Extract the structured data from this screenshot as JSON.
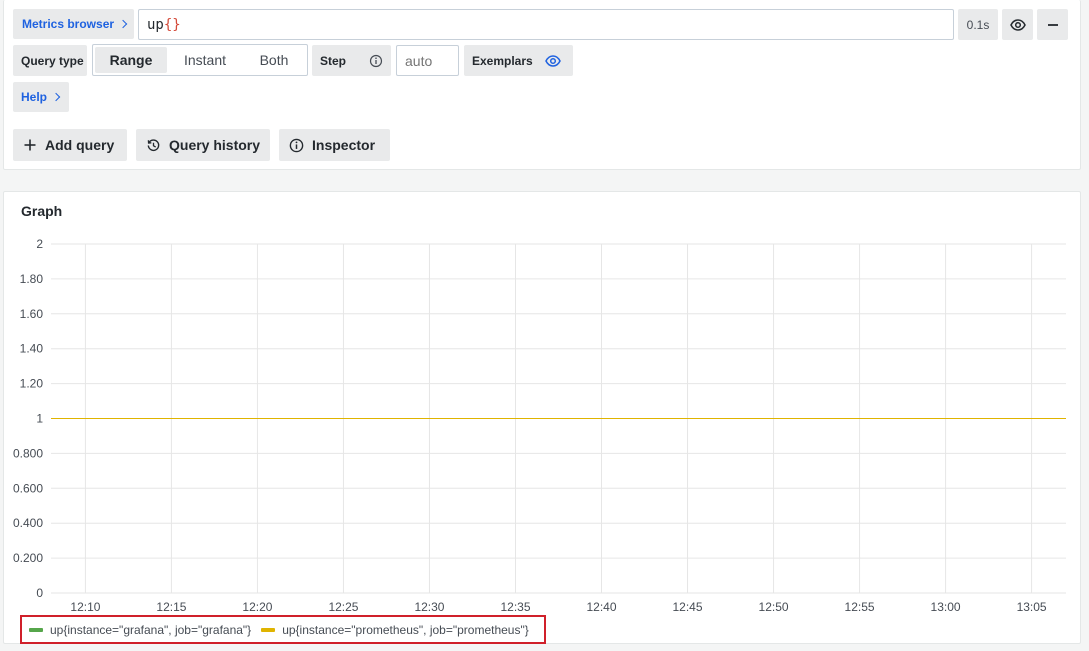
{
  "query_editor": {
    "metrics_browser_label": "Metrics browser",
    "query_text": "up",
    "query_braces_open": "{",
    "query_braces_close": "}",
    "query_time": "0.1s",
    "query_type_label": "Query type",
    "query_type_options": [
      "Range",
      "Instant",
      "Both"
    ],
    "query_type_selected": "Range",
    "step_label": "Step",
    "step_placeholder": "auto",
    "exemplars_label": "Exemplars",
    "help_label": "Help",
    "add_query_label": "Add query",
    "query_history_label": "Query history",
    "inspector_label": "Inspector"
  },
  "icons": {
    "eye": "eye-icon",
    "minus": "minus-icon",
    "info": "info-icon",
    "plus": "plus-icon",
    "history": "history-icon",
    "chevron": "chevron-right-icon"
  },
  "colors": {
    "link": "#1f62e0",
    "series_grafana": "#56a64b",
    "series_prometheus": "#e0b400",
    "legend_highlight": "#d0202a"
  },
  "graph": {
    "title": "Graph"
  },
  "chart_data": {
    "type": "line",
    "title": "Graph",
    "xlabel": "",
    "ylabel": "",
    "x_ticks": [
      "12:10",
      "12:15",
      "12:20",
      "12:25",
      "12:30",
      "12:35",
      "12:40",
      "12:45",
      "12:50",
      "12:55",
      "13:00",
      "13:05"
    ],
    "y_ticks": [
      "0",
      "0.200",
      "0.400",
      "0.600",
      "0.800",
      "1",
      "1.20",
      "1.40",
      "1.60",
      "1.80",
      "2"
    ],
    "ylim": [
      0,
      2
    ],
    "xlim": [
      "12:08",
      "13:07"
    ],
    "grid": true,
    "legend_position": "bottom-left",
    "series": [
      {
        "name": "up{instance=\"grafana\", job=\"grafana\"}",
        "color": "#56a64b",
        "x": [
          "12:08",
          "13:07"
        ],
        "values": [
          1,
          1
        ]
      },
      {
        "name": "up{instance=\"prometheus\", job=\"prometheus\"}",
        "color": "#e0b400",
        "x": [
          "12:08",
          "13:07"
        ],
        "values": [
          1,
          1
        ]
      }
    ]
  }
}
